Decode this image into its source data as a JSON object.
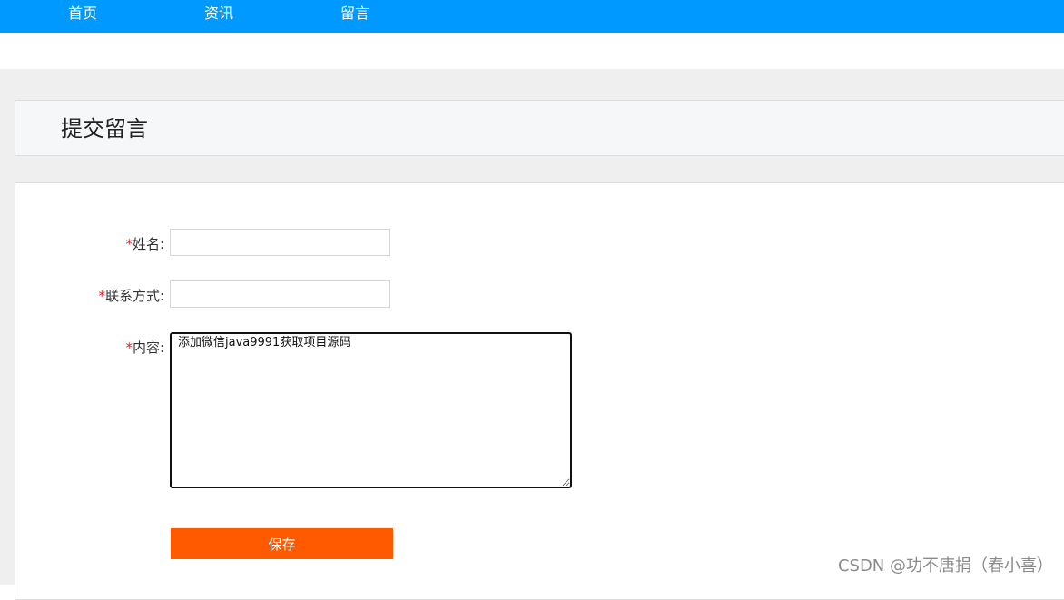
{
  "nav": {
    "home": "首页",
    "news": "资讯",
    "message": "留言"
  },
  "page": {
    "title": "提交留言"
  },
  "form": {
    "required_mark": "*",
    "name_label": "姓名:",
    "name_value": "",
    "contact_label": "联系方式:",
    "contact_value": "",
    "content_label": "内容:",
    "content_value": "添加微信java9991获取项目源码",
    "save_label": "保存"
  },
  "watermark": "CSDN @功不唐捐（春小喜）",
  "colors": {
    "topbar": "#0099ff",
    "save_button": "#ff5a00",
    "required": "#e02020"
  }
}
